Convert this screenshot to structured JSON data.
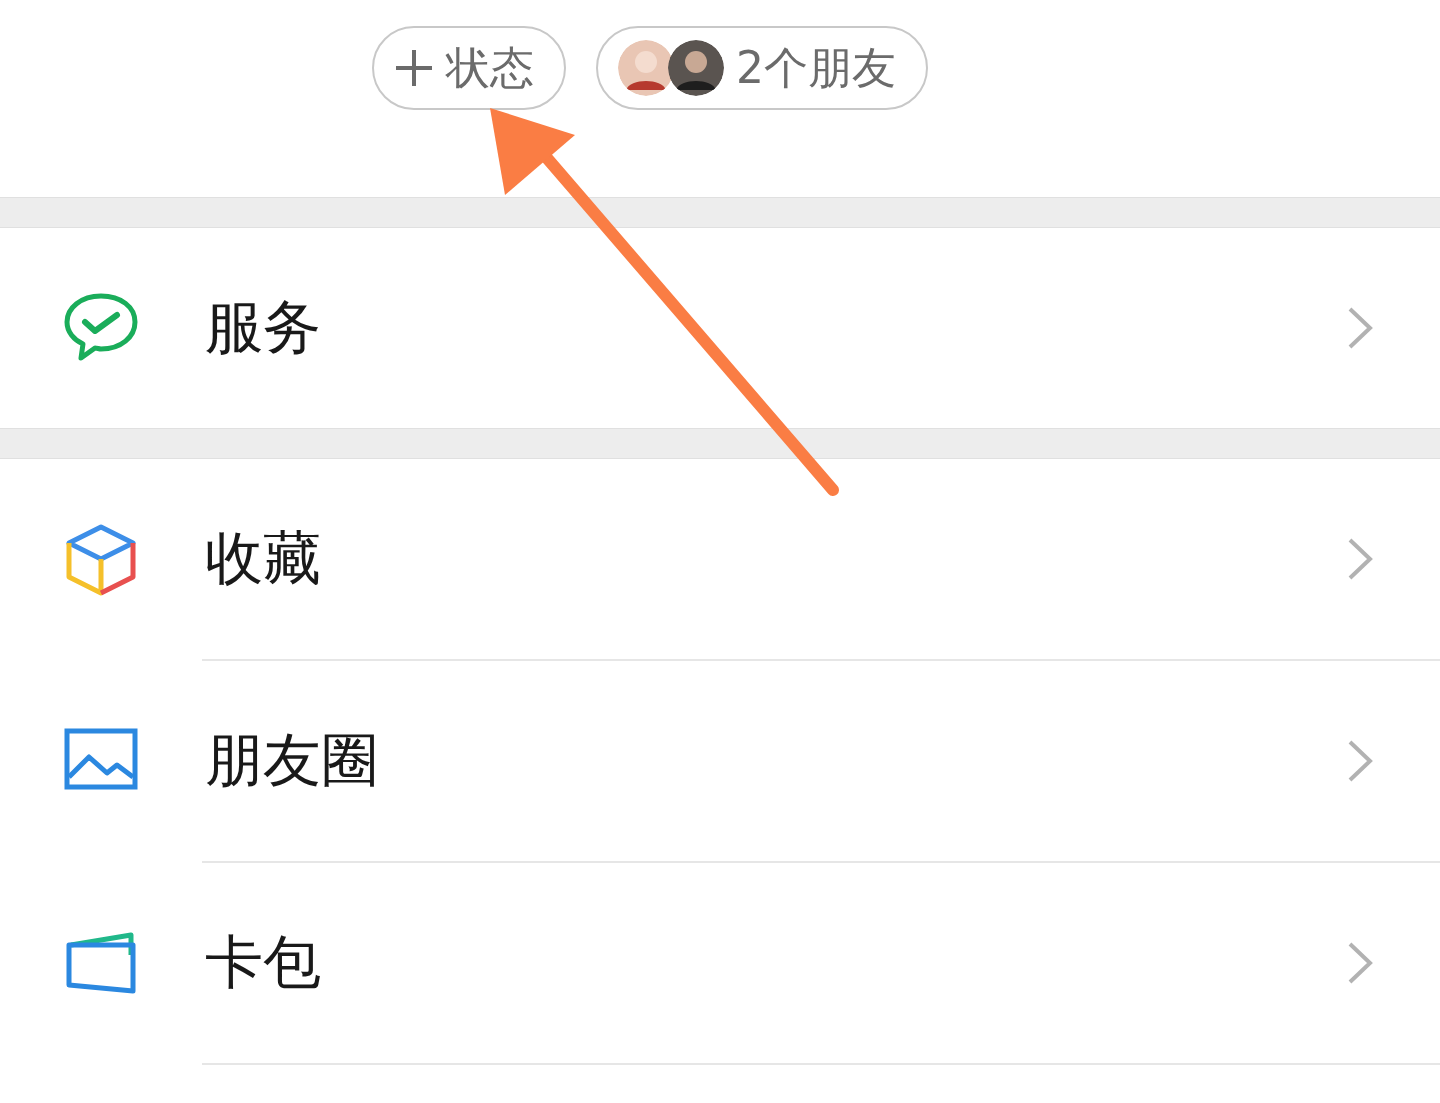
{
  "header": {
    "status_button": {
      "label": "状态"
    },
    "friends_button": {
      "label": "2个朋友"
    }
  },
  "menu_groups": [
    {
      "items": [
        {
          "kind": "service",
          "label": "服务"
        }
      ]
    },
    {
      "items": [
        {
          "kind": "favorites",
          "label": "收藏"
        },
        {
          "kind": "moments",
          "label": "朋友圈"
        },
        {
          "kind": "cards",
          "label": "卡包"
        }
      ]
    }
  ]
}
